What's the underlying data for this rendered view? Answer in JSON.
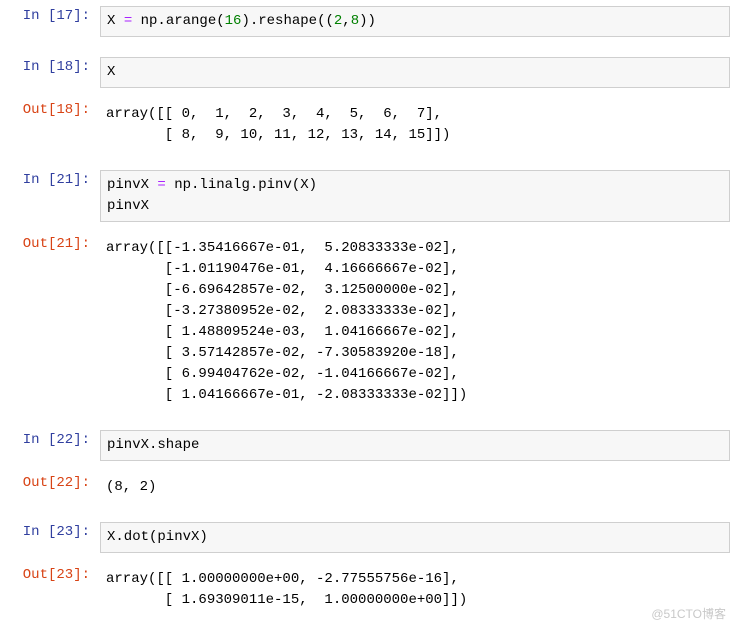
{
  "cells": [
    {
      "type": "in",
      "num": "17",
      "html": "X <span class='tok-op'>=</span> np.arange(<span class='tok-num'>16</span>).reshape((<span class='tok-num'>2</span>,<span class='tok-num'>8</span>))"
    },
    {
      "type": "in",
      "num": "18",
      "html": "X"
    },
    {
      "type": "out",
      "num": "18",
      "text": "array([[ 0,  1,  2,  3,  4,  5,  6,  7],\n       [ 8,  9, 10, 11, 12, 13, 14, 15]])"
    },
    {
      "type": "in",
      "num": "21",
      "html": "pinvX <span class='tok-op'>=</span> np.linalg.pinv(X)\npinvX"
    },
    {
      "type": "out",
      "num": "21",
      "text": "array([[-1.35416667e-01,  5.20833333e-02],\n       [-1.01190476e-01,  4.16666667e-02],\n       [-6.69642857e-02,  3.12500000e-02],\n       [-3.27380952e-02,  2.08333333e-02],\n       [ 1.48809524e-03,  1.04166667e-02],\n       [ 3.57142857e-02, -7.30583920e-18],\n       [ 6.99404762e-02, -1.04166667e-02],\n       [ 1.04166667e-01, -2.08333333e-02]])"
    },
    {
      "type": "in",
      "num": "22",
      "html": "pinvX.shape"
    },
    {
      "type": "out",
      "num": "22",
      "text": "(8, 2)"
    },
    {
      "type": "in",
      "num": "23",
      "html": "X.dot(pinvX)"
    },
    {
      "type": "out",
      "num": "23",
      "text": "array([[ 1.00000000e+00, -2.77555756e-16],\n       [ 1.69309011e-15,  1.00000000e+00]])"
    }
  ],
  "prompts": {
    "in_prefix": "In  [",
    "out_prefix": "Out[",
    "suffix": "]:"
  },
  "watermark": "@51CTO博客",
  "chart_data": {
    "type": "table",
    "description": "Jupyter notebook cells computing pseudo-inverse of a 2x8 matrix",
    "X": [
      [
        0,
        1,
        2,
        3,
        4,
        5,
        6,
        7
      ],
      [
        8,
        9,
        10,
        11,
        12,
        13,
        14,
        15
      ]
    ],
    "pinvX": [
      [
        -0.135416667,
        0.0520833333
      ],
      [
        -0.101190476,
        0.0416666667
      ],
      [
        -0.0669642857,
        0.03125
      ],
      [
        -0.0327380952,
        0.0208333333
      ],
      [
        0.00148809524,
        0.0104166667
      ],
      [
        0.0357142857,
        -7.3058392e-18
      ],
      [
        0.0699404762,
        -0.0104166667
      ],
      [
        0.104166667,
        -0.0208333333
      ]
    ],
    "pinvX_shape": [
      8,
      2
    ],
    "X_dot_pinvX": [
      [
        1.0,
        -2.77555756e-16
      ],
      [
        1.69309011e-15,
        1.0
      ]
    ]
  }
}
